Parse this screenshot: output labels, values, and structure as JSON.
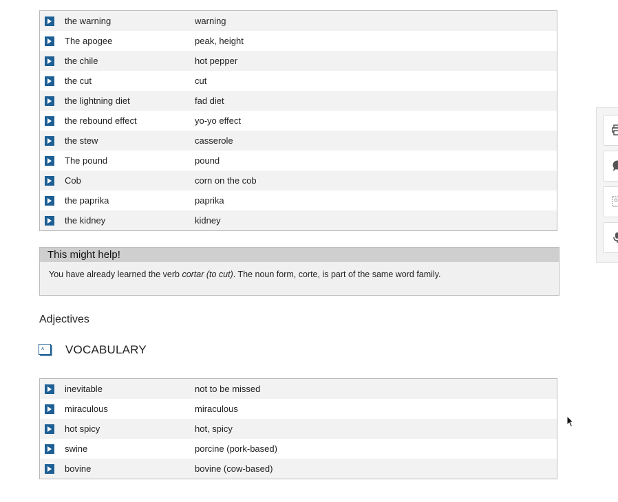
{
  "nouns_table": {
    "rows": [
      {
        "term": "the warning",
        "meaning": "warning"
      },
      {
        "term": "The apogee",
        "meaning": "peak, height"
      },
      {
        "term": "the chile",
        "meaning": "hot pepper"
      },
      {
        "term": "the cut",
        "meaning": "cut"
      },
      {
        "term": "the lightning diet",
        "meaning": "fad diet"
      },
      {
        "term": "the rebound effect",
        "meaning": "yo-yo effect"
      },
      {
        "term": "the stew",
        "meaning": "casserole"
      },
      {
        "term": "The pound",
        "meaning": "pound"
      },
      {
        "term": "Cob",
        "meaning": "corn on the cob"
      },
      {
        "term": "the paprika",
        "meaning": "paprika"
      },
      {
        "term": "the kidney",
        "meaning": "kidney"
      }
    ]
  },
  "help_box": {
    "title": "This might help!",
    "text_before": "You have already learned the verb ",
    "text_italic": "cortar (to cut)",
    "text_after": ". The noun form, corte, is part of the same word family."
  },
  "adjectives_section": {
    "heading": "Adjectives",
    "vocab_label": "VOCABULARY"
  },
  "adjectives_table": {
    "rows": [
      {
        "term": "inevitable",
        "meaning": "not to be missed"
      },
      {
        "term": "miraculous",
        "meaning": "miraculous"
      },
      {
        "term": "hot spicy",
        "meaning": "hot, spicy"
      },
      {
        "term": "swine",
        "meaning": "porcine (pork-based)"
      },
      {
        "term": "bovine",
        "meaning": "bovine (cow-based)"
      }
    ]
  },
  "side_toolbar": {
    "icons": [
      "print-icon",
      "comment-icon",
      "image-icon",
      "microphone-icon"
    ]
  },
  "colors": {
    "play_button": "#1d5f94",
    "row_shade": "#f2f2f2",
    "help_title_bg": "#cfcfcf",
    "help_bg": "#f0f0f0"
  }
}
